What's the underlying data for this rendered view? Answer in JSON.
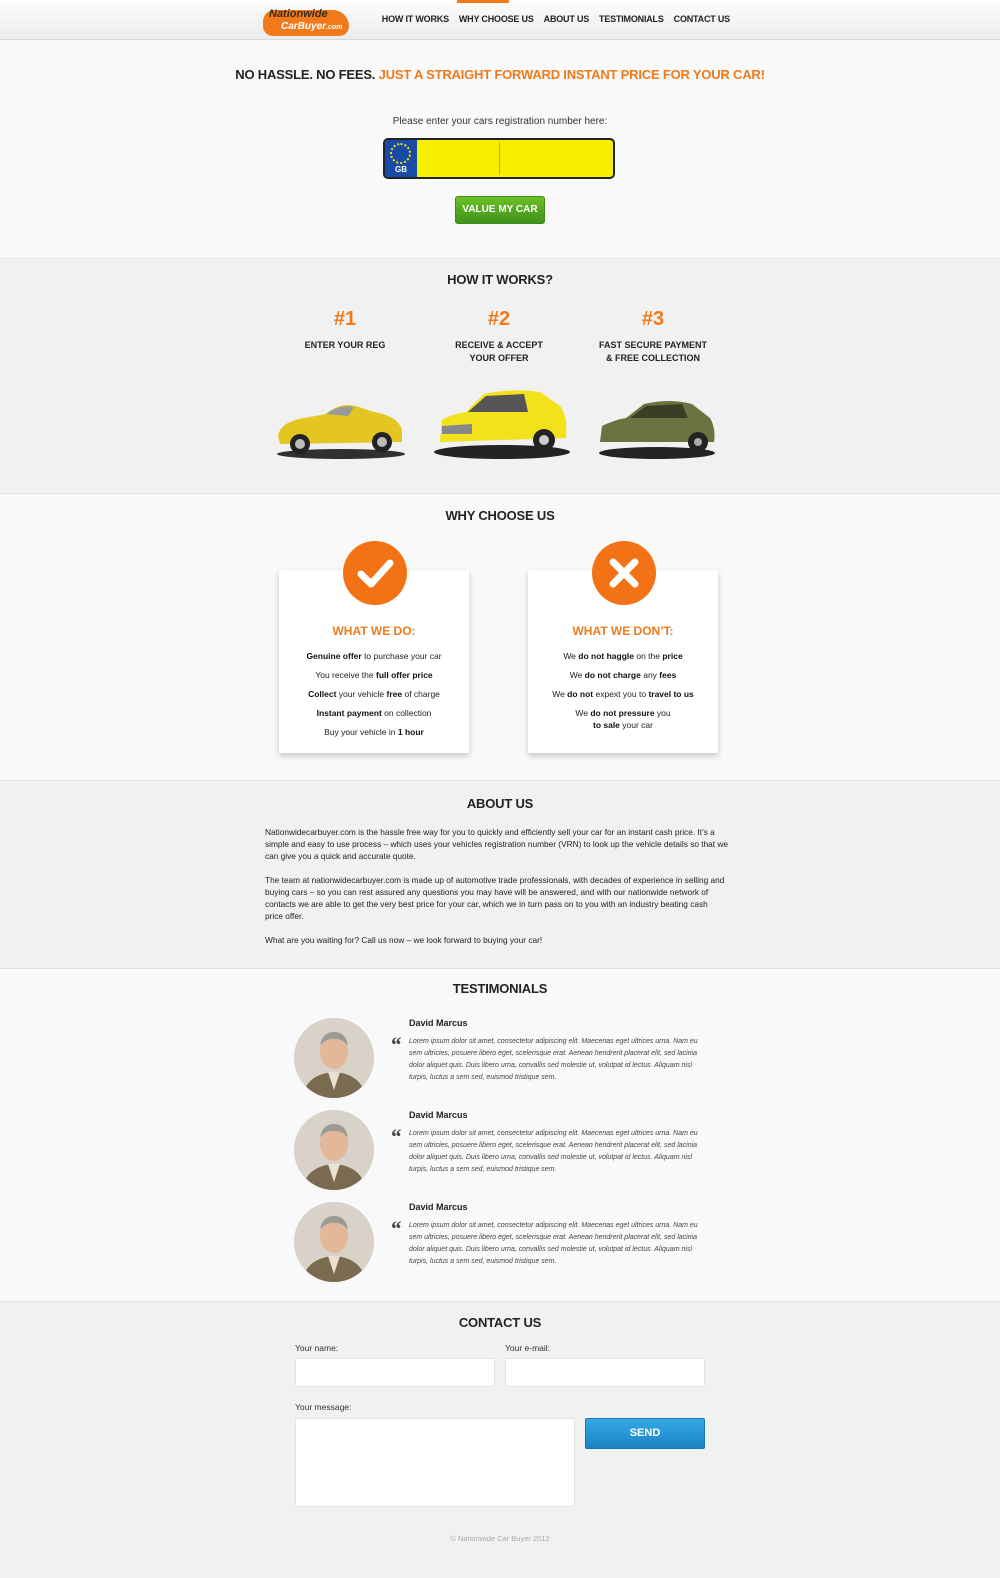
{
  "brand": {
    "line1": "Nationwide",
    "line2": "CarBuyer",
    "suffix": ".com"
  },
  "nav": [
    "HOW IT WORKS",
    "WHY CHOOSE US",
    "ABOUT US",
    "TESTIMONIALS",
    "CONTACT US"
  ],
  "hero": {
    "tagline_plain": "NO HASSLE. NO FEES. ",
    "tagline_accent": "JUST A STRAIGHT FORWARD INSTANT PRICE FOR YOUR CAR!",
    "reg_label": "Please enter your cars registration number here:",
    "plate_country": "GB",
    "reg_value": "",
    "button": "VALUE MY CAR"
  },
  "how": {
    "title": "HOW IT WORKS?",
    "steps": [
      {
        "num": "#1",
        "label": "ENTER YOUR REG"
      },
      {
        "num": "#2",
        "label": "RECEIVE & ACCEPT\nYOUR OFFER"
      },
      {
        "num": "#3",
        "label": "FAST SECURE PAYMENT\n& FREE COLLECTION"
      }
    ],
    "car_colors": [
      "#e3c622",
      "#f2e21c",
      "#6b7342"
    ]
  },
  "why": {
    "title": "WHY CHOOSE US",
    "do": {
      "heading": "WHAT WE DO:",
      "items": [
        [
          {
            "b": "Genuine offer"
          },
          {
            "t": " to purchase your car"
          }
        ],
        [
          {
            "t": "You receive the "
          },
          {
            "b": "full offer price"
          }
        ],
        [
          {
            "b": "Collect"
          },
          {
            "t": " your vehicle "
          },
          {
            "b": "free"
          },
          {
            "t": " of charge"
          }
        ],
        [
          {
            "b": "Instant payment"
          },
          {
            "t": " on collection"
          }
        ],
        [
          {
            "t": "Buy your vehicle in "
          },
          {
            "b": "1 hour"
          }
        ]
      ]
    },
    "dont": {
      "heading": "WHAT WE DON’T:",
      "items": [
        [
          {
            "t": "We "
          },
          {
            "b": "do not haggle"
          },
          {
            "t": " on the "
          },
          {
            "b": "price"
          }
        ],
        [
          {
            "t": "We "
          },
          {
            "b": "do not charge"
          },
          {
            "t": " any "
          },
          {
            "b": "fees"
          }
        ],
        [
          {
            "t": "We "
          },
          {
            "b": "do not"
          },
          {
            "t": " expext you to "
          },
          {
            "b": "travel to us"
          }
        ],
        [
          {
            "t": "We "
          },
          {
            "b": "do not pressure"
          },
          {
            "t": " you\n"
          },
          {
            "b": "to sale"
          },
          {
            "t": " your car"
          }
        ]
      ]
    },
    "accent": "#f47216"
  },
  "about": {
    "title": "ABOUT US",
    "paragraphs": [
      "Nationwidecarbuyer.com is the hassle free way for you to quickly and efficiently sell your car for an instant cash price. It’s a simple and easy to use process – which uses your vehicles registration number (VRN) to look up the vehicle details so that we can give you a quick and accurate quote.",
      "The team at nationwidecarbuyer.com is made up of automotive trade professionals, with decades of experience in selling and buying cars – so you can rest assured any questions you may have will be answered, and with our nationwide network of contacts we are able to get the very best price for your car, which we in turn pass on to you with an industry beating cash price offer.",
      "What are you waiting for? Call us now – we look forward to buying your car!"
    ]
  },
  "testimonials": {
    "title": "TESTIMONIALS",
    "items": [
      {
        "name": "David Marcus",
        "text": "Lorem ipsum dolor sit amet, consectetur adipiscing elit. Maecenas eget ultrices urna. Nam eu sem ultricies, posuere libero eget, scelerisque erat. Aenean hendrerit placerat elit, sed lacinia dolor aliquet quis. Duis libero urna, convallis sed molestie ut, volutpat id lectus. Aliquam nisl turpis, luctus a sem sed, euismod tristique sem."
      },
      {
        "name": "David Marcus",
        "text": "Lorem ipsum dolor sit amet, consectetur adipiscing elit. Maecenas eget ultrices urna. Nam eu sem ultricies, posuere libero eget, scelerisque erat. Aenean hendrerit placerat elit, sed lacinia dolor aliquet quis. Duis libero urna, convallis sed molestie ut, volutpat id lectus. Aliquam nisl turpis, luctus a sem sed, euismod tristique sem."
      },
      {
        "name": "David Marcus",
        "text": "Lorem ipsum dolor sit amet, consectetur adipiscing elit. Maecenas eget ultrices urna. Nam eu sem ultricies, posuere libero eget, scelerisque erat. Aenean hendrerit placerat elit, sed lacinia dolor aliquet quis. Duis libero urna, convallis sed molestie ut, volutpat id lectus. Aliquam nisl turpis, luctus a sem sed, euismod tristique sem."
      }
    ]
  },
  "contact": {
    "title": "CONTACT US",
    "name_label": "Your name:",
    "email_label": "Your e-mail:",
    "message_label": "Your message:",
    "name_value": "",
    "email_value": "",
    "message_value": "",
    "send": "SEND"
  },
  "footer": "© Nationwide Car Buyer 2012",
  "colors": {
    "accent": "#f07a1a",
    "green": "#4ea41f",
    "blue": "#1f8fd3",
    "plate": "#f7ee00"
  }
}
